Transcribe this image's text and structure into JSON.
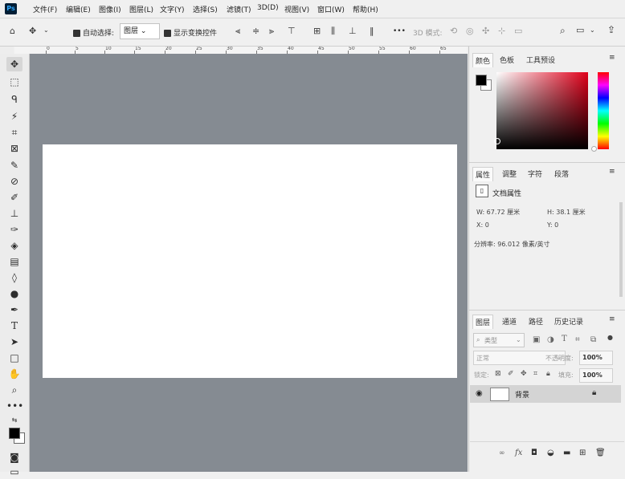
{
  "app": {
    "logo_text": "Ps"
  },
  "menu": [
    "文件(F)",
    "编辑(E)",
    "图像(I)",
    "图层(L)",
    "文字(Y)",
    "选择(S)",
    "滤镜(T)",
    "3D(D)",
    "视图(V)",
    "窗口(W)",
    "帮助(H)"
  ],
  "options_bar": {
    "auto_select_label": "自动选择:",
    "auto_select_value": "图层",
    "show_transform_label": "显示变换控件",
    "more_label": "•••",
    "mode_3d_label": "3D 模式:"
  },
  "ruler": {
    "marks": [
      "0",
      "5",
      "10",
      "15",
      "20",
      "25",
      "30",
      "35",
      "40",
      "45",
      "50",
      "55",
      "60",
      "65"
    ]
  },
  "tools": [
    "move-tool",
    "marquee-tool",
    "lasso-tool",
    "magic-wand-tool",
    "crop-tool",
    "frame-tool",
    "eyedropper-tool",
    "spot-healing-tool",
    "brush-tool",
    "clone-stamp-tool",
    "history-brush-tool",
    "eraser-tool",
    "gradient-tool",
    "blur-tool",
    "dodge-tool",
    "pen-tool",
    "type-tool",
    "path-selection-tool",
    "rectangle-tool",
    "hand-tool",
    "zoom-tool",
    "more-tools",
    "swap-colors-icon",
    "color-swatches",
    "quick-mask-icon",
    "screen-mode-icon"
  ],
  "color_panel": {
    "tabs": [
      "颜色",
      "色板",
      "工具预设"
    ],
    "foreground": "#000000",
    "background": "#ffffff"
  },
  "properties_panel": {
    "tabs": [
      "属性",
      "调整",
      "字符",
      "段落"
    ],
    "doc_label": "文档属性",
    "width": "W: 67.72 厘米",
    "height": "H: 38.1 厘米",
    "x": "X: 0",
    "y": "Y: 0",
    "resolution": "分辨率: 96.012 像素/英寸"
  },
  "layers_panel": {
    "tabs": [
      "图层",
      "通道",
      "路径",
      "历史记录"
    ],
    "filter_label": "类型",
    "blend_mode": "正常",
    "opacity_label": "不透明度:",
    "opacity_value": "100%",
    "lock_label": "锁定:",
    "fill_label": "填充:",
    "fill_value": "100%",
    "layers": [
      {
        "name": "背景",
        "visible": true,
        "locked": true
      }
    ]
  }
}
